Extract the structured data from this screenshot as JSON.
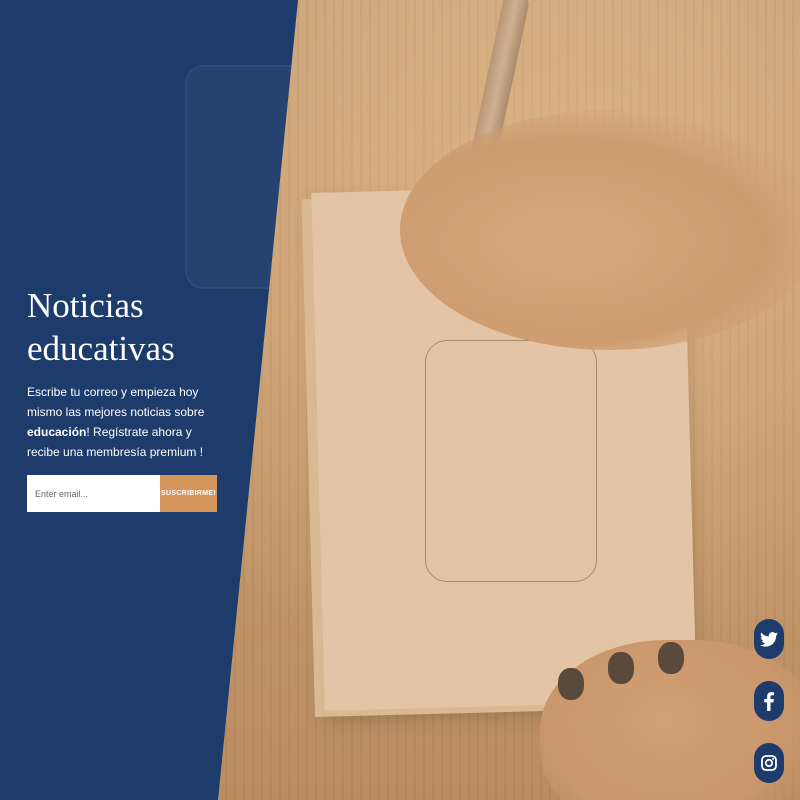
{
  "hero": {
    "title_line1": "Noticias",
    "title_line2": "educativas",
    "desc_before": "Escribe tu correo y empieza hoy mismo las mejores noticias sobre ",
    "desc_bold": "educación",
    "desc_after": "! Regístrate ahora y recibe una membresía premium !"
  },
  "form": {
    "email_placeholder": "Enter email...",
    "subscribe_label": "SUSCRIBIRME!"
  },
  "social": {
    "icons": [
      "twitter-icon",
      "facebook-icon",
      "instagram-icon"
    ]
  },
  "colors": {
    "overlay": "#1d3b6b",
    "accent": "#d4955a",
    "text": "#ffffff"
  }
}
